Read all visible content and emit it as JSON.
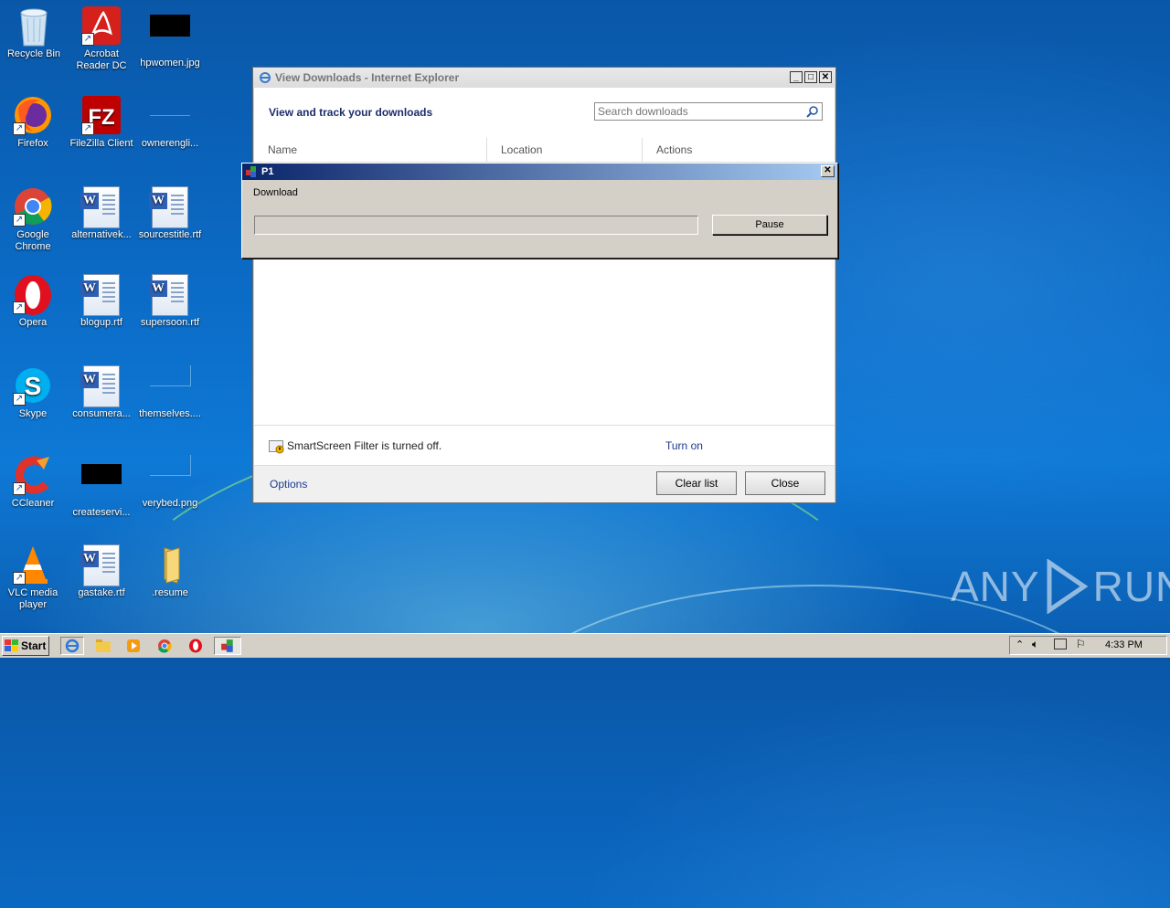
{
  "desktop": {
    "icons": [
      {
        "label": "Recycle Bin"
      },
      {
        "label": "Acrobat Reader DC"
      },
      {
        "label": "hpwomen.jpg"
      },
      {
        "label": "Firefox"
      },
      {
        "label": "FileZilla Client"
      },
      {
        "label": "ownerengli..."
      },
      {
        "label": "Google Chrome"
      },
      {
        "label": "alternativek..."
      },
      {
        "label": "sourcestitle.rtf"
      },
      {
        "label": "Opera"
      },
      {
        "label": "blogup.rtf"
      },
      {
        "label": "supersoon.rtf"
      },
      {
        "label": "Skype"
      },
      {
        "label": "consumera..."
      },
      {
        "label": "themselves...."
      },
      {
        "label": "CCleaner"
      },
      {
        "label": "createservi..."
      },
      {
        "label": "verybed.png"
      },
      {
        "label": "VLC media player"
      },
      {
        "label": "gastake.rtf"
      },
      {
        "label": ".resume"
      }
    ]
  },
  "ie_window": {
    "title": "View Downloads - Internet Explorer",
    "heading": "View and track your downloads",
    "search_placeholder": "Search downloads",
    "columns": [
      "Name",
      "Location",
      "Actions"
    ],
    "smartscreen_text": "SmartScreen Filter is turned off.",
    "turn_on_label": "Turn on",
    "options_label": "Options",
    "clear_list_label": "Clear list",
    "close_label": "Close"
  },
  "p1_dialog": {
    "title": "P1",
    "label": "Download",
    "progress": 0,
    "pause_label": "Pause"
  },
  "taskbar": {
    "start_label": "Start",
    "clock": "4:33 PM"
  },
  "watermark": {
    "text_left": "ANY",
    "text_right": "RUN"
  },
  "colors": {
    "desktop_bg": "#0b6cc7",
    "title_active": "#0a246a",
    "link": "#1a3a8f"
  }
}
